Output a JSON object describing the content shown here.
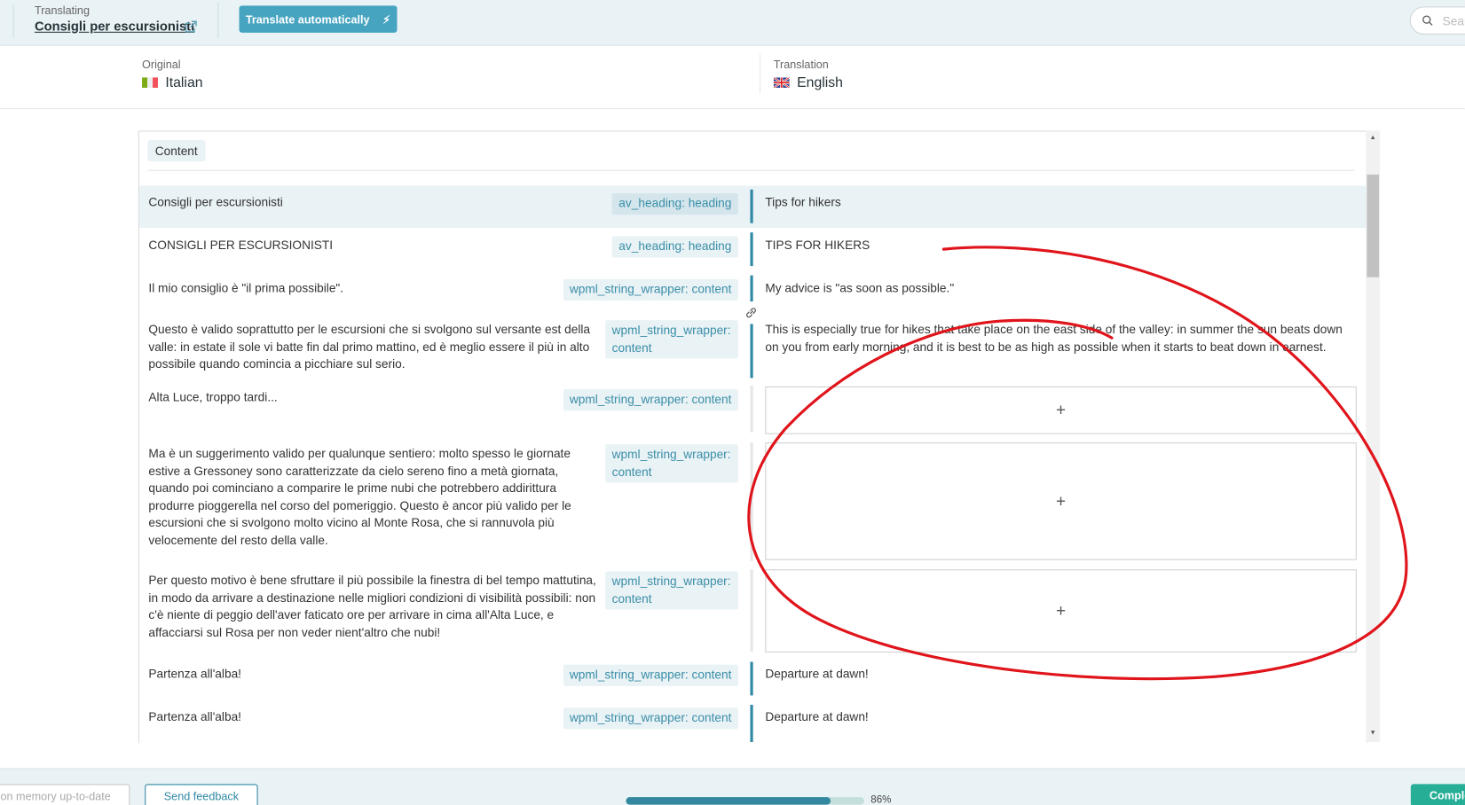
{
  "header": {
    "translating_label": "Translating",
    "doc_title": "Consigli per escursionisti",
    "auto_button": "Translate automatically",
    "search_placeholder": "Search"
  },
  "languages": {
    "original_label": "Original",
    "original_lang": "Italian",
    "translation_label": "Translation",
    "translation_lang": "English"
  },
  "section_chip": "Content",
  "rows": [
    {
      "source": "Consigli per escursionisti",
      "tag": "av_heading: heading",
      "translation": "Tips for hikers"
    },
    {
      "source": "CONSIGLI PER ESCURSIONISTI",
      "tag": "av_heading: heading",
      "translation": "TIPS FOR HIKERS"
    },
    {
      "source": "Il mio consiglio è \"il prima possibile\".",
      "tag": "wpml_string_wrapper: content",
      "translation": "My advice is \"as soon as possible.\""
    },
    {
      "source": "Questo è valido soprattutto per le escursioni che si svolgono sul versante est della valle: in estate il sole vi batte fin dal primo mattino, ed è meglio essere il più in alto possibile quando comincia a picchiare sul serio.",
      "tag": "wpml_string_wrapper: content",
      "translation": "This is especially true for hikes that take place on the east side of the valley: in summer the sun beats down on you from early morning, and it is best to be as high as possible when it starts to beat down in earnest."
    },
    {
      "source": "Alta Luce, troppo tardi...",
      "tag": "wpml_string_wrapper: content",
      "translation": "+"
    },
    {
      "source": "Ma è un suggerimento valido per qualunque sentiero: molto spesso le giornate estive a Gressoney sono caratterizzate da cielo sereno fino a metà giornata, quando poi cominciano a comparire le prime nubi che potrebbero addirittura produrre pioggerella nel corso del pomeriggio. Questo è ancor più valido per le escursioni che si svolgono molto vicino al Monte Rosa, che si rannuvola più velocemente del resto della valle.",
      "tag": "wpml_string_wrapper: content",
      "translation": "+"
    },
    {
      "source": "Per questo motivo è bene sfruttare il più possibile la finestra di bel tempo mattutina, in modo da arrivare a destinazione nelle migliori condizioni di visibilità possibili: non c'è niente di peggio dell'aver faticato ore per arrivare in cima all'Alta Luce, e affacciarsi sul Rosa per non veder nient'altro che nubi!",
      "tag": "wpml_string_wrapper: content",
      "translation": "+"
    },
    {
      "source": "Partenza all'alba!",
      "tag": "wpml_string_wrapper: content",
      "translation": "Departure at dawn!"
    },
    {
      "source": "Partenza all'alba!",
      "tag": "wpml_string_wrapper: content",
      "translation": "Departure at dawn!"
    }
  ],
  "footer": {
    "memory_button": "on memory up-to-date",
    "feedback_button": "Send feedback",
    "progress_percent": 86,
    "progress_label": "86%",
    "complete_button": "Complete"
  },
  "colors": {
    "accent": "#46a4c0",
    "bar": "#2f89a4",
    "complete": "#26ae96",
    "annotation": "#e0141b"
  }
}
